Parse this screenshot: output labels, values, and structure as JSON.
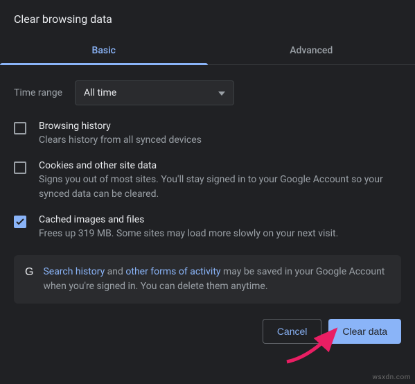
{
  "title": "Clear browsing data",
  "tabs": {
    "basic": "Basic",
    "advanced": "Advanced"
  },
  "time": {
    "label": "Time range",
    "value": "All time"
  },
  "options": [
    {
      "checked": false,
      "title": "Browsing history",
      "desc": "Clears history from all synced devices"
    },
    {
      "checked": false,
      "title": "Cookies and other site data",
      "desc": "Signs you out of most sites. You'll stay signed in to your Google Account so your synced data can be cleared."
    },
    {
      "checked": true,
      "title": "Cached images and files",
      "desc": "Frees up 319 MB. Some sites may load more slowly on your next visit."
    }
  ],
  "notice": {
    "icon": "G",
    "link1": "Search history",
    "mid1": " and ",
    "link2": "other forms of activity",
    "rest": " may be saved in your Google Account when you're signed in. You can delete them anytime."
  },
  "buttons": {
    "cancel": "Cancel",
    "clear": "Clear data"
  },
  "watermark": "wsxdn.com"
}
